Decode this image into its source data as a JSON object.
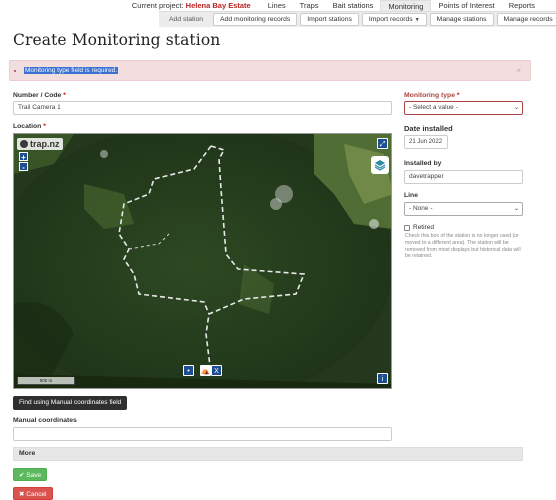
{
  "topnav": {
    "project_prefix": "Current project:",
    "project_name": "Helena Bay Estate",
    "items": [
      "Lines",
      "Traps",
      "Bait stations",
      "Monitoring",
      "Points of Interest",
      "Reports"
    ],
    "active": "Monitoring"
  },
  "subnav": {
    "add_station": "Add station",
    "add_records": "Add monitoring records",
    "import_stations": "Import stations",
    "import_records": "Import records",
    "manage_stations": "Manage stations",
    "manage_records": "Manage records"
  },
  "page_title": "Create Monitoring station",
  "alert": {
    "message": "Monitoring type field is required.",
    "close": "×"
  },
  "form": {
    "number_label": "Number / Code",
    "number_value": "Trail Camera 1",
    "location_label": "Location",
    "monitoring_type_label": "Monitoring type",
    "monitoring_type_value": "- Select a value -",
    "date_label": "Date installed",
    "date_value": "21 Jun 2022",
    "installed_by_label": "Installed by",
    "installed_by_value": "davetrapper",
    "line_label": "Line",
    "line_value": "- None -",
    "retired_label": "Retired",
    "retired_help": "Check this box of the station is no longer used (or moved to a different area). The station will be removed from most displays but historical data will be retained.",
    "manual_coords_label": "Manual coordinates",
    "manual_coords_value": "",
    "required_mark": "*"
  },
  "map": {
    "logo": "trap.nz",
    "zoom_in": "+",
    "zoom_out": "-",
    "scale": "500 m",
    "expand_icon": "expand-icon",
    "layers_icon": "layers-icon",
    "info": "i",
    "bottom_buttons": [
      "•",
      "⛺",
      "X"
    ]
  },
  "buttons": {
    "find_coords": "Find using Manual coordinates field",
    "more": "More",
    "save": "Save",
    "cancel": "Cancel"
  },
  "colors": {
    "error_text": "#a94442",
    "error_bg": "#f2dede",
    "save": "#5cb85c",
    "cancel": "#d9534f",
    "project": "#b22222"
  }
}
